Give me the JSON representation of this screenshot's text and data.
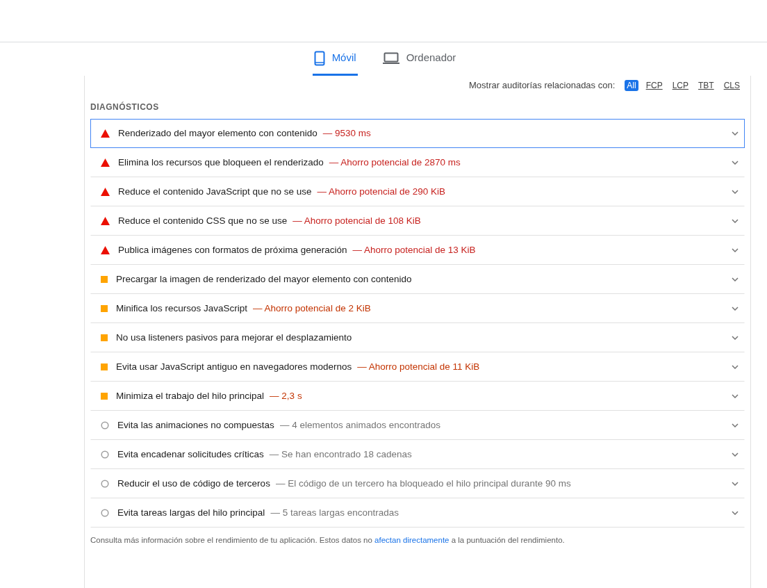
{
  "tabs": [
    {
      "label": "Móvil",
      "kind": "phone",
      "selected": true
    },
    {
      "label": "Ordenador",
      "kind": "laptop",
      "selected": false
    }
  ],
  "filter": {
    "label": "Mostrar auditorías relacionadas con:",
    "options": [
      {
        "label": "All",
        "selected": true
      },
      {
        "label": "FCP",
        "selected": false
      },
      {
        "label": "LCP",
        "selected": false
      },
      {
        "label": "TBT",
        "selected": false
      },
      {
        "label": "CLS",
        "selected": false
      }
    ]
  },
  "section_title": "DIAGNÓSTICOS",
  "audits": [
    {
      "kind": "fail",
      "title": "Renderizado del mayor elemento con contenido",
      "detail": "— 9530 ms",
      "selected": true
    },
    {
      "kind": "fail",
      "title": "Elimina los recursos que bloqueen el renderizado",
      "detail": "— Ahorro potencial de 2870 ms",
      "selected": false
    },
    {
      "kind": "fail",
      "title": "Reduce el contenido JavaScript que no se use",
      "detail": "— Ahorro potencial de 290 KiB",
      "selected": false
    },
    {
      "kind": "fail",
      "title": "Reduce el contenido CSS que no se use",
      "detail": "— Ahorro potencial de 108 KiB",
      "selected": false
    },
    {
      "kind": "fail",
      "title": "Publica imágenes con formatos de próxima generación",
      "detail": "— Ahorro potencial de 13 KiB",
      "selected": false
    },
    {
      "kind": "average",
      "title": "Precargar la imagen de renderizado del mayor elemento con contenido",
      "selected": false
    },
    {
      "kind": "average",
      "title": "Minifica los recursos JavaScript",
      "detail": "— Ahorro potencial de 2 KiB",
      "selected": false
    },
    {
      "kind": "average",
      "title": "No usa listeners pasivos para mejorar el desplazamiento",
      "selected": false
    },
    {
      "kind": "average",
      "title": "Evita usar JavaScript antiguo en navegadores modernos",
      "detail": "— Ahorro potencial de 11 KiB",
      "selected": false
    },
    {
      "kind": "average",
      "title": "Minimiza el trabajo del hilo principal",
      "detail": "— 2,3 s",
      "selected": false
    },
    {
      "kind": "info",
      "title": "Evita las animaciones no compuestas",
      "detail": "— 4 elementos animados encontrados",
      "selected": false
    },
    {
      "kind": "info",
      "title": "Evita encadenar solicitudes críticas",
      "detail": "— Se han encontrado 18 cadenas",
      "selected": false
    },
    {
      "kind": "info",
      "title": "Reducir el uso de código de terceros",
      "detail": "— El código de un tercero ha bloqueado el hilo principal durante 90 ms",
      "selected": false
    },
    {
      "kind": "info",
      "title": "Evita tareas largas del hilo principal",
      "detail": "— 5 tareas largas encontradas",
      "selected": false
    }
  ],
  "footer": {
    "before": "Consulta más información sobre el rendimiento de tu aplicación. Estos datos no",
    "link": "afectan directamente",
    "after": "a la puntuación del rendimiento."
  }
}
